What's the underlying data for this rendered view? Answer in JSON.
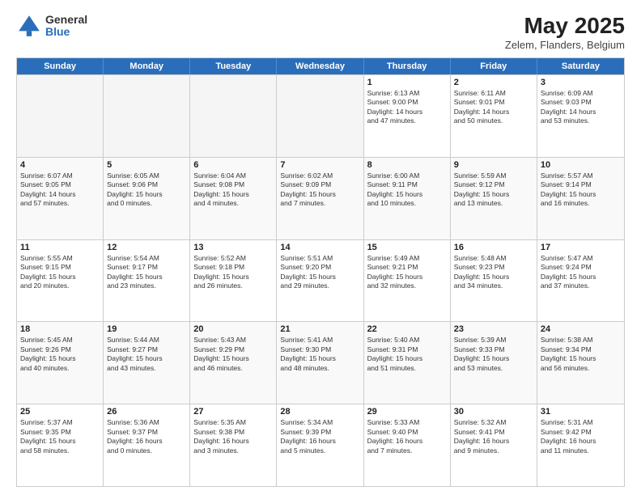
{
  "header": {
    "logo_general": "General",
    "logo_blue": "Blue",
    "month_title": "May 2025",
    "location": "Zelem, Flanders, Belgium"
  },
  "days_of_week": [
    "Sunday",
    "Monday",
    "Tuesday",
    "Wednesday",
    "Thursday",
    "Friday",
    "Saturday"
  ],
  "weeks": [
    [
      {
        "day": "",
        "text": "",
        "empty": true
      },
      {
        "day": "",
        "text": "",
        "empty": true
      },
      {
        "day": "",
        "text": "",
        "empty": true
      },
      {
        "day": "",
        "text": "",
        "empty": true
      },
      {
        "day": "1",
        "text": "Sunrise: 6:13 AM\nSunset: 9:00 PM\nDaylight: 14 hours\nand 47 minutes."
      },
      {
        "day": "2",
        "text": "Sunrise: 6:11 AM\nSunset: 9:01 PM\nDaylight: 14 hours\nand 50 minutes."
      },
      {
        "day": "3",
        "text": "Sunrise: 6:09 AM\nSunset: 9:03 PM\nDaylight: 14 hours\nand 53 minutes."
      }
    ],
    [
      {
        "day": "4",
        "text": "Sunrise: 6:07 AM\nSunset: 9:05 PM\nDaylight: 14 hours\nand 57 minutes."
      },
      {
        "day": "5",
        "text": "Sunrise: 6:05 AM\nSunset: 9:06 PM\nDaylight: 15 hours\nand 0 minutes."
      },
      {
        "day": "6",
        "text": "Sunrise: 6:04 AM\nSunset: 9:08 PM\nDaylight: 15 hours\nand 4 minutes."
      },
      {
        "day": "7",
        "text": "Sunrise: 6:02 AM\nSunset: 9:09 PM\nDaylight: 15 hours\nand 7 minutes."
      },
      {
        "day": "8",
        "text": "Sunrise: 6:00 AM\nSunset: 9:11 PM\nDaylight: 15 hours\nand 10 minutes."
      },
      {
        "day": "9",
        "text": "Sunrise: 5:59 AM\nSunset: 9:12 PM\nDaylight: 15 hours\nand 13 minutes."
      },
      {
        "day": "10",
        "text": "Sunrise: 5:57 AM\nSunset: 9:14 PM\nDaylight: 15 hours\nand 16 minutes."
      }
    ],
    [
      {
        "day": "11",
        "text": "Sunrise: 5:55 AM\nSunset: 9:15 PM\nDaylight: 15 hours\nand 20 minutes."
      },
      {
        "day": "12",
        "text": "Sunrise: 5:54 AM\nSunset: 9:17 PM\nDaylight: 15 hours\nand 23 minutes."
      },
      {
        "day": "13",
        "text": "Sunrise: 5:52 AM\nSunset: 9:18 PM\nDaylight: 15 hours\nand 26 minutes."
      },
      {
        "day": "14",
        "text": "Sunrise: 5:51 AM\nSunset: 9:20 PM\nDaylight: 15 hours\nand 29 minutes."
      },
      {
        "day": "15",
        "text": "Sunrise: 5:49 AM\nSunset: 9:21 PM\nDaylight: 15 hours\nand 32 minutes."
      },
      {
        "day": "16",
        "text": "Sunrise: 5:48 AM\nSunset: 9:23 PM\nDaylight: 15 hours\nand 34 minutes."
      },
      {
        "day": "17",
        "text": "Sunrise: 5:47 AM\nSunset: 9:24 PM\nDaylight: 15 hours\nand 37 minutes."
      }
    ],
    [
      {
        "day": "18",
        "text": "Sunrise: 5:45 AM\nSunset: 9:26 PM\nDaylight: 15 hours\nand 40 minutes."
      },
      {
        "day": "19",
        "text": "Sunrise: 5:44 AM\nSunset: 9:27 PM\nDaylight: 15 hours\nand 43 minutes."
      },
      {
        "day": "20",
        "text": "Sunrise: 5:43 AM\nSunset: 9:29 PM\nDaylight: 15 hours\nand 46 minutes."
      },
      {
        "day": "21",
        "text": "Sunrise: 5:41 AM\nSunset: 9:30 PM\nDaylight: 15 hours\nand 48 minutes."
      },
      {
        "day": "22",
        "text": "Sunrise: 5:40 AM\nSunset: 9:31 PM\nDaylight: 15 hours\nand 51 minutes."
      },
      {
        "day": "23",
        "text": "Sunrise: 5:39 AM\nSunset: 9:33 PM\nDaylight: 15 hours\nand 53 minutes."
      },
      {
        "day": "24",
        "text": "Sunrise: 5:38 AM\nSunset: 9:34 PM\nDaylight: 15 hours\nand 56 minutes."
      }
    ],
    [
      {
        "day": "25",
        "text": "Sunrise: 5:37 AM\nSunset: 9:35 PM\nDaylight: 15 hours\nand 58 minutes."
      },
      {
        "day": "26",
        "text": "Sunrise: 5:36 AM\nSunset: 9:37 PM\nDaylight: 16 hours\nand 0 minutes."
      },
      {
        "day": "27",
        "text": "Sunrise: 5:35 AM\nSunset: 9:38 PM\nDaylight: 16 hours\nand 3 minutes."
      },
      {
        "day": "28",
        "text": "Sunrise: 5:34 AM\nSunset: 9:39 PM\nDaylight: 16 hours\nand 5 minutes."
      },
      {
        "day": "29",
        "text": "Sunrise: 5:33 AM\nSunset: 9:40 PM\nDaylight: 16 hours\nand 7 minutes."
      },
      {
        "day": "30",
        "text": "Sunrise: 5:32 AM\nSunset: 9:41 PM\nDaylight: 16 hours\nand 9 minutes."
      },
      {
        "day": "31",
        "text": "Sunrise: 5:31 AM\nSunset: 9:42 PM\nDaylight: 16 hours\nand 11 minutes."
      }
    ]
  ]
}
